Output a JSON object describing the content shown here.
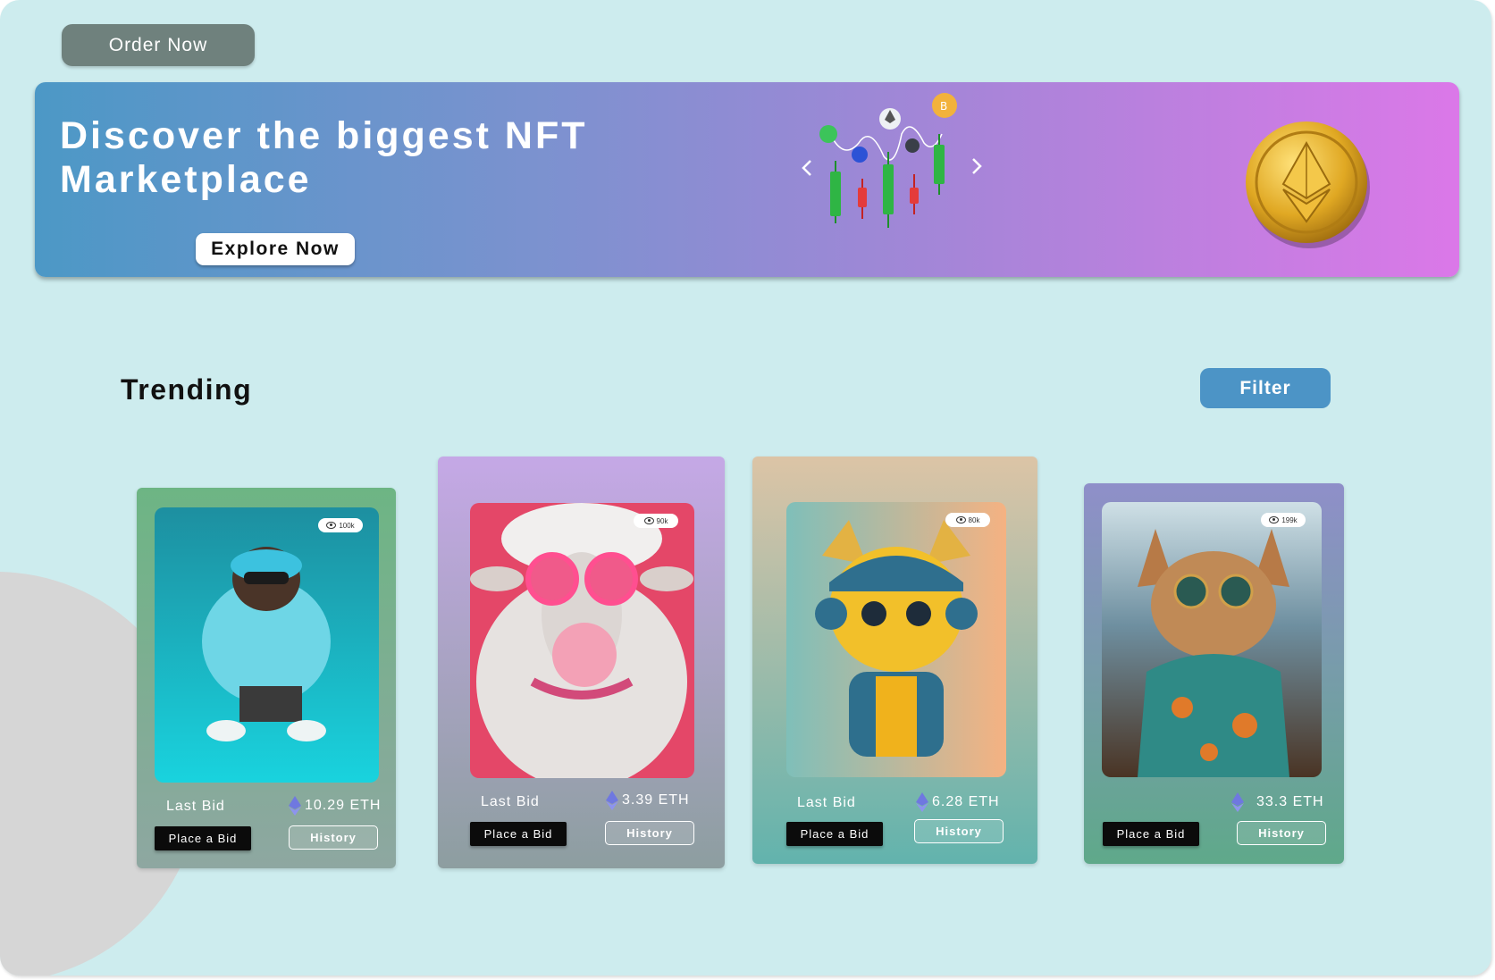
{
  "header": {
    "order_label": "Order Now"
  },
  "banner": {
    "title": "Discover the biggest NFT Marketplace",
    "explore_label": "Explore Now",
    "gradient": [
      "#4c98c6",
      "#a685d8",
      "#db78e8"
    ]
  },
  "section": {
    "title": "Trending",
    "filter_label": "Filter"
  },
  "cards": [
    {
      "views": "100k",
      "bid_label": "Last Bid",
      "price": "10.29 ETH",
      "place_label": "Place a Bid",
      "history_label": "History",
      "art": "monkey-with-cap-and-sunglasses"
    },
    {
      "views": "90k",
      "bid_label": "Last Bid",
      "price": "3.39 ETH",
      "place_label": "Place a Bid",
      "history_label": "History",
      "art": "sheep-with-pink-glasses-bubblegum"
    },
    {
      "views": "80k",
      "bid_label": "Last Bid",
      "price": "6.28 ETH",
      "place_label": "Place a Bid",
      "history_label": "History",
      "art": "tiger-cub-with-headphones"
    },
    {
      "views": "199k",
      "bid_label": "",
      "price": "33.3 ETH",
      "place_label": "Place a Bid",
      "history_label": "History",
      "art": "cat-with-sunglasses-on-boat"
    }
  ],
  "colors": {
    "background": "#cdecee",
    "order_button": "#6f817d",
    "filter_button": "#4c94c6",
    "place_button": "#0b0b0b",
    "eth_icon": "#6f78e0"
  }
}
